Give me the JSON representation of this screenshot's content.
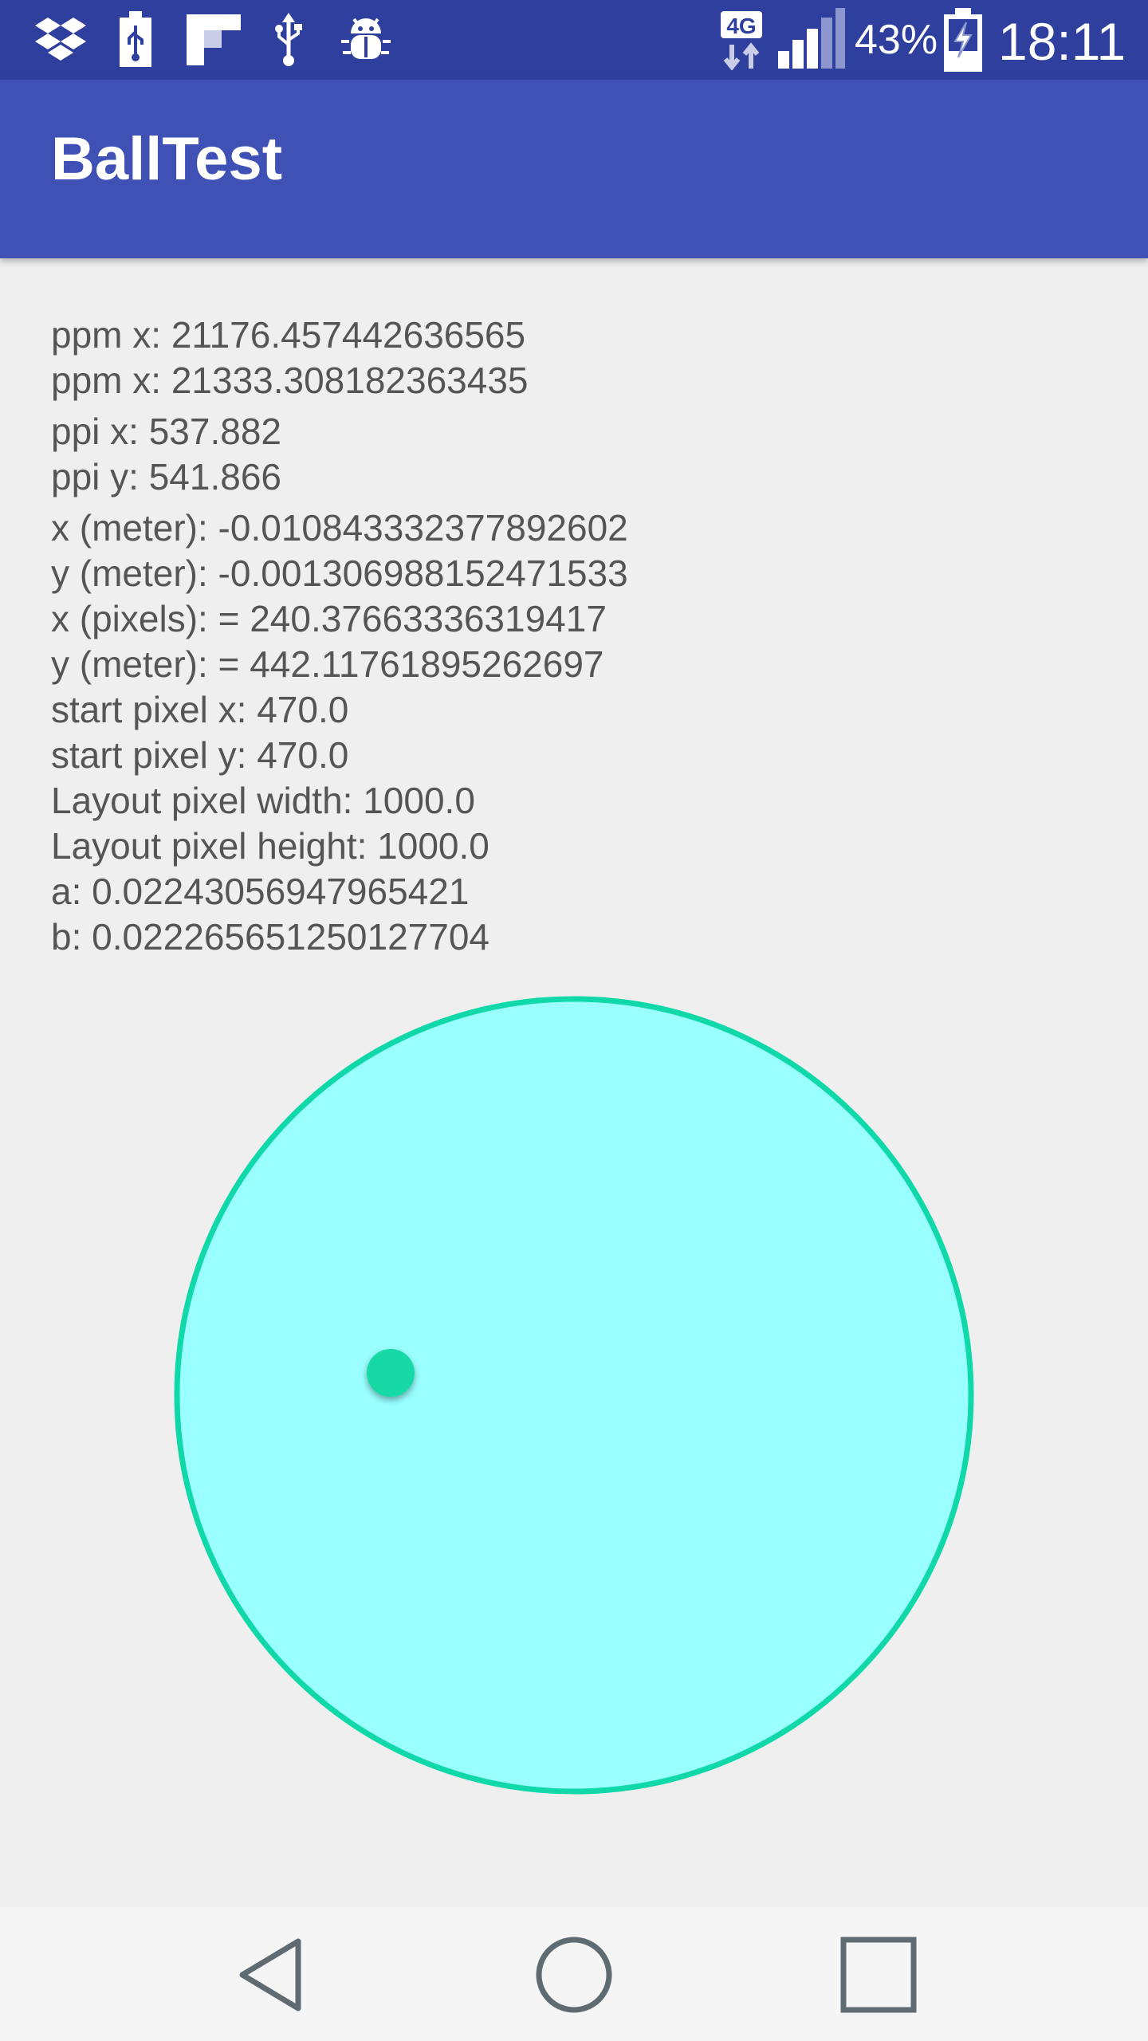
{
  "status_bar": {
    "network_type": "4G",
    "battery_percent": "43%",
    "time": "18:11",
    "icons": [
      "dropbox-icon",
      "usb-battery-icon",
      "flipboard-icon",
      "usb-icon",
      "android-debug-icon"
    ]
  },
  "app_bar": {
    "title": "BallTest"
  },
  "info_lines": [
    "ppm x: 21176.457442636565",
    "ppm x: 21333.308182363435",
    "ppi x: 537.882",
    "ppi y: 541.866",
    "x (meter): -0.010843332377892602",
    "y (meter): -0.0013069881524715​33",
    "x (pixels):  = 240.37663336319417",
    "y (meter):  = 442.11761895262697",
    "start pixel x: 470.0",
    "start pixel y: 470.0",
    "Layout pixel width: 1000.0",
    "Layout pixel height: 1000.0",
    "a: 0.022430569479654​21",
    "b: 0.022265651250127704"
  ],
  "colors": {
    "status_bar": "#2f3f9e",
    "app_bar": "#3f51b5",
    "circle_fill": "#99ffff",
    "circle_stroke": "#11d8a8",
    "ball": "#13d9a6",
    "background": "#efefef"
  },
  "nav_bar": {
    "back": "back-icon",
    "home": "home-icon",
    "recents": "recents-icon"
  }
}
